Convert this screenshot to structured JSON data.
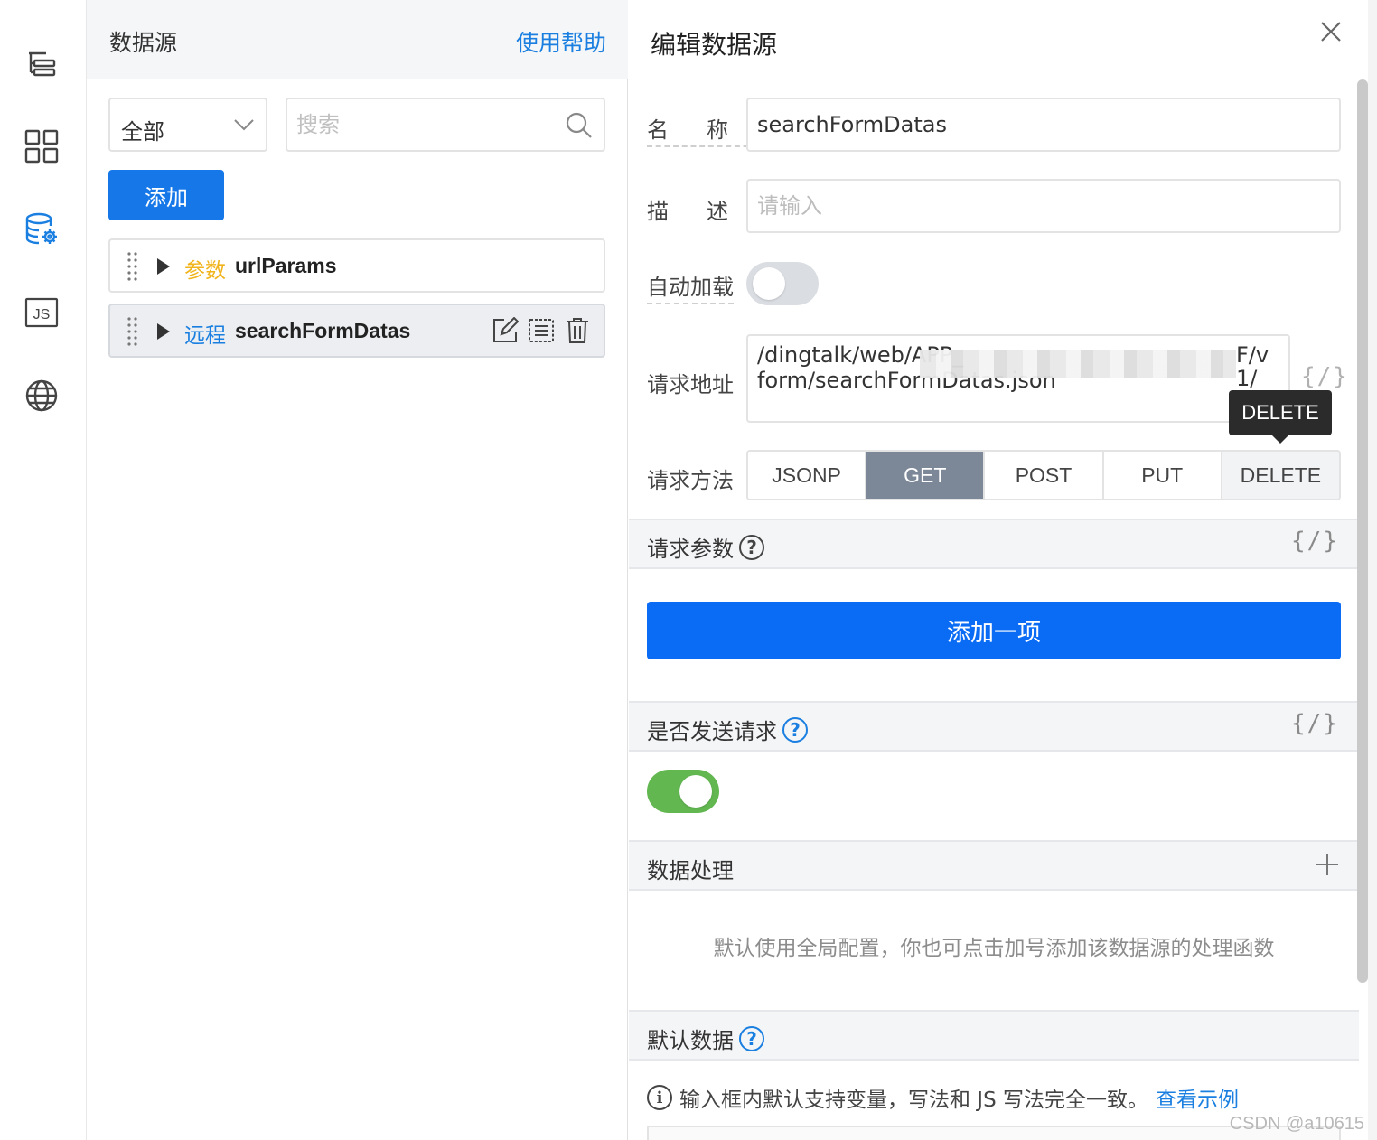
{
  "rail": {
    "icons": [
      "outline-icon",
      "components-icon",
      "datasource-icon",
      "js-icon",
      "globe-icon"
    ],
    "js_label": "JS"
  },
  "datasource_panel": {
    "title": "数据源",
    "help_link": "使用帮助",
    "filter": {
      "value": "全部"
    },
    "search": {
      "placeholder": "搜索"
    },
    "add_button": "添加",
    "items": [
      {
        "tag": "参数",
        "name": "urlParams",
        "type": "params"
      },
      {
        "tag": "远程",
        "name": "searchFormDatas",
        "type": "remote",
        "selected": true
      }
    ]
  },
  "editor": {
    "title": "编辑数据源",
    "name_label": "名称",
    "name_value": "searchFormDatas",
    "desc_label": "描述",
    "desc_placeholder": "请输入",
    "autoload_label": "自动加载",
    "autoload_on": false,
    "url_label": "请求地址",
    "url_line1_start": "/dingtalk/web/APP_",
    "url_line1_end": "F/v1/",
    "url_line2": "form/searchFormDatas.json",
    "code_toggle": "{/}",
    "method_label": "请求方法",
    "methods": [
      "JSONP",
      "GET",
      "POST",
      "PUT",
      "DELETE"
    ],
    "selected_method": "GET",
    "tooltip": "DELETE",
    "params_section": "请求参数",
    "add_item_button": "添加一项",
    "send_section": "是否发送请求",
    "send_on": true,
    "process_section": "数据处理",
    "process_hint": "默认使用全局配置，你也可点击加号添加该数据源的处理函数",
    "default_section": "默认数据",
    "default_hint": "输入框内默认支持变量，写法和 JS 写法完全一致。",
    "default_link": "查看示例",
    "help_mark": "?",
    "info_mark": "i"
  },
  "watermark": "CSDN @a10615",
  "colors": {
    "primary": "#1677e8",
    "selected_method": "#7c8898",
    "toggle_on": "#62b751",
    "params_tag": "#f0b31a"
  }
}
